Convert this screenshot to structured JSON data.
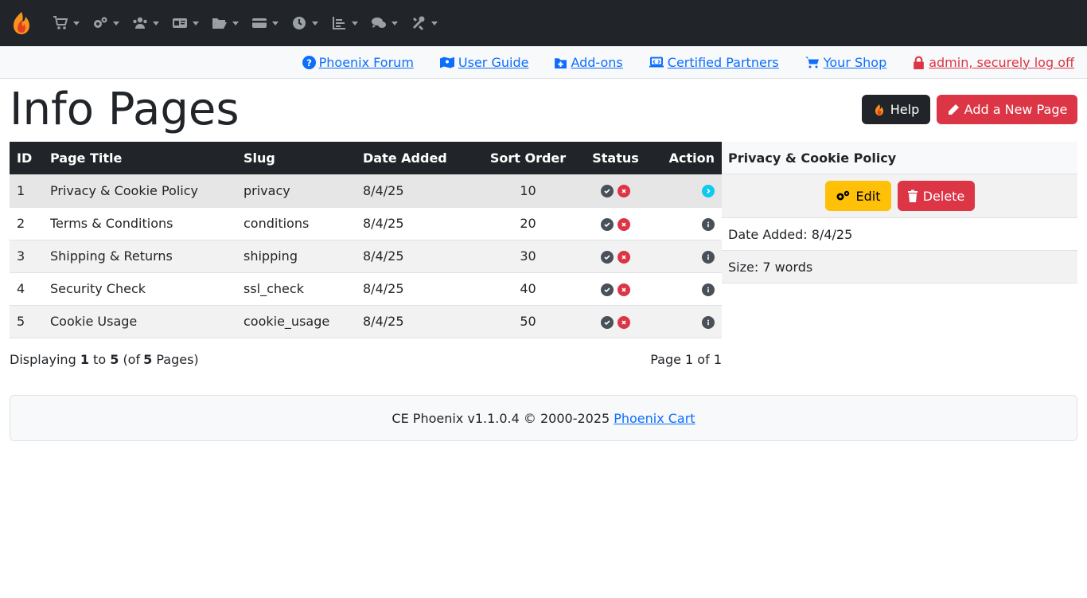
{
  "navbar": {
    "logo_icon": "phoenix-flame-icon",
    "menus": [
      {
        "icon": "cart-icon"
      },
      {
        "icon": "gears-icon"
      },
      {
        "icon": "users-icon"
      },
      {
        "icon": "id-card-icon"
      },
      {
        "icon": "folder-open-icon"
      },
      {
        "icon": "credit-card-icon"
      },
      {
        "icon": "clock-icon"
      },
      {
        "icon": "chart-icon"
      },
      {
        "icon": "comments-icon"
      },
      {
        "icon": "tools-icon"
      }
    ]
  },
  "links": {
    "forum": "Phoenix Forum",
    "guide": "User Guide",
    "addons": "Add-ons",
    "partners": "Certified Partners",
    "shop": "Your Shop",
    "logoff": "admin, securely log off"
  },
  "header": {
    "title": "Info Pages",
    "help_label": "Help",
    "add_label": "Add a New Page"
  },
  "table": {
    "headers": {
      "id": "ID",
      "title": "Page Title",
      "slug": "Slug",
      "date": "Date Added",
      "sort": "Sort Order",
      "status": "Status",
      "action": "Action"
    },
    "rows": [
      {
        "id": "1",
        "title": "Privacy & Cookie Policy",
        "slug": "privacy",
        "date": "8/4/25",
        "sort": "10"
      },
      {
        "id": "2",
        "title": "Terms & Conditions",
        "slug": "conditions",
        "date": "8/4/25",
        "sort": "20"
      },
      {
        "id": "3",
        "title": "Shipping & Returns",
        "slug": "shipping",
        "date": "8/4/25",
        "sort": "30"
      },
      {
        "id": "4",
        "title": "Security Check",
        "slug": "ssl_check",
        "date": "8/4/25",
        "sort": "40"
      },
      {
        "id": "5",
        "title": "Cookie Usage",
        "slug": "cookie_usage",
        "date": "8/4/25",
        "sort": "50"
      }
    ],
    "selected_index": 0
  },
  "side": {
    "title": "Privacy & Cookie Policy",
    "edit_label": "Edit",
    "delete_label": "Delete",
    "date_added": "Date Added: 8/4/25",
    "size": "Size: 7 words"
  },
  "paging": {
    "displaying_prefix": "Displaying",
    "from": "1",
    "to_word": "to",
    "to": "5",
    "of_prefix": "(of",
    "total": "5",
    "of_suffix": "Pages)",
    "page_info": "Page 1 of 1"
  },
  "footer": {
    "text": "CE Phoenix v1.1.0.4 © 2000-2025",
    "link": "Phoenix Cart"
  },
  "colors": {
    "dark": "#212529",
    "primary": "#0d6efd",
    "danger": "#dc3545",
    "warning": "#ffc107",
    "info": "#0dcaf0"
  }
}
